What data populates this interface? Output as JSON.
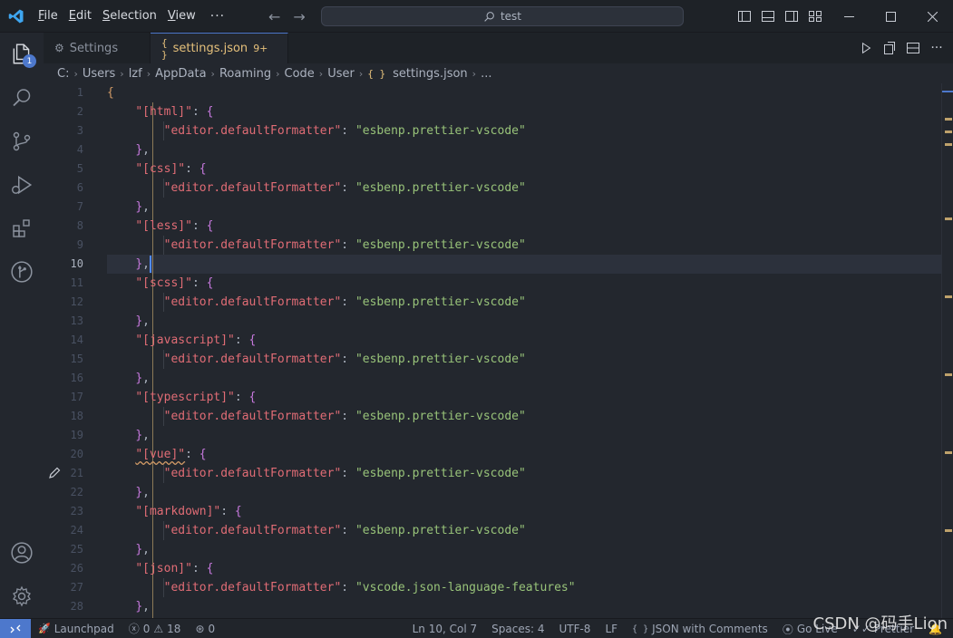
{
  "titlebar": {
    "menu": [
      {
        "label": "File",
        "mnemonic": "F",
        "rest": "ile"
      },
      {
        "label": "Edit",
        "mnemonic": "E",
        "rest": "dit"
      },
      {
        "label": "Selection",
        "mnemonic": "S",
        "rest": "election"
      },
      {
        "label": "View",
        "mnemonic": "V",
        "rest": "iew"
      }
    ],
    "more": "···",
    "search_text": "test"
  },
  "activity": {
    "explorer_badge": "1"
  },
  "tabs": [
    {
      "label": "Settings",
      "icon": "gear-icon"
    },
    {
      "label": "settings.json",
      "icon": "json-braces-icon",
      "problems": "9+"
    }
  ],
  "breadcrumb": [
    "C:",
    "Users",
    "lzf",
    "AppData",
    "Roaming",
    "Code",
    "User",
    "settings.json",
    "..."
  ],
  "breadcrumb_json_icon": "{ }",
  "editor": {
    "current_line": 10,
    "line_numbers": [
      "1",
      "2",
      "3",
      "4",
      "5",
      "6",
      "7",
      "8",
      "9",
      "10",
      "11",
      "12",
      "13",
      "14",
      "15",
      "16",
      "17",
      "18",
      "19",
      "20",
      "21",
      "22",
      "23",
      "24",
      "25",
      "26",
      "27",
      "28"
    ],
    "lines": [
      {
        "indent": 0,
        "parts": [
          {
            "t": "{",
            "c": "brace1"
          }
        ]
      },
      {
        "indent": 1,
        "parts": [
          {
            "t": "\"[html]\"",
            "c": "k"
          },
          {
            "t": ": ",
            "c": "p"
          },
          {
            "t": "{",
            "c": "brace2"
          }
        ]
      },
      {
        "indent": 2,
        "parts": [
          {
            "t": "\"editor.defaultFormatter\"",
            "c": "k"
          },
          {
            "t": ": ",
            "c": "p"
          },
          {
            "t": "\"esbenp.prettier-vscode\"",
            "c": "s"
          }
        ]
      },
      {
        "indent": 1,
        "parts": [
          {
            "t": "}",
            "c": "brace2"
          },
          {
            "t": ",",
            "c": "p"
          }
        ]
      },
      {
        "indent": 1,
        "parts": [
          {
            "t": "\"[css]\"",
            "c": "k"
          },
          {
            "t": ": ",
            "c": "p"
          },
          {
            "t": "{",
            "c": "brace2"
          }
        ]
      },
      {
        "indent": 2,
        "parts": [
          {
            "t": "\"editor.defaultFormatter\"",
            "c": "k"
          },
          {
            "t": ": ",
            "c": "p"
          },
          {
            "t": "\"esbenp.prettier-vscode\"",
            "c": "s"
          }
        ]
      },
      {
        "indent": 1,
        "parts": [
          {
            "t": "}",
            "c": "brace2"
          },
          {
            "t": ",",
            "c": "p"
          }
        ]
      },
      {
        "indent": 1,
        "parts": [
          {
            "t": "\"[less]\"",
            "c": "k"
          },
          {
            "t": ": ",
            "c": "p"
          },
          {
            "t": "{",
            "c": "brace2"
          }
        ]
      },
      {
        "indent": 2,
        "parts": [
          {
            "t": "\"editor.defaultFormatter\"",
            "c": "k"
          },
          {
            "t": ": ",
            "c": "p"
          },
          {
            "t": "\"esbenp.prettier-vscode\"",
            "c": "s"
          }
        ]
      },
      {
        "indent": 1,
        "parts": [
          {
            "t": "}",
            "c": "brace2"
          },
          {
            "t": ",",
            "c": "p"
          }
        ]
      },
      {
        "indent": 1,
        "parts": [
          {
            "t": "\"[scss]\"",
            "c": "k"
          },
          {
            "t": ": ",
            "c": "p"
          },
          {
            "t": "{",
            "c": "brace2"
          }
        ]
      },
      {
        "indent": 2,
        "parts": [
          {
            "t": "\"editor.defaultFormatter\"",
            "c": "k"
          },
          {
            "t": ": ",
            "c": "p"
          },
          {
            "t": "\"esbenp.prettier-vscode\"",
            "c": "s"
          }
        ]
      },
      {
        "indent": 1,
        "parts": [
          {
            "t": "}",
            "c": "brace2"
          },
          {
            "t": ",",
            "c": "p"
          }
        ]
      },
      {
        "indent": 1,
        "parts": [
          {
            "t": "\"[javascript]\"",
            "c": "k"
          },
          {
            "t": ": ",
            "c": "p"
          },
          {
            "t": "{",
            "c": "brace2"
          }
        ]
      },
      {
        "indent": 2,
        "parts": [
          {
            "t": "\"editor.defaultFormatter\"",
            "c": "k"
          },
          {
            "t": ": ",
            "c": "p"
          },
          {
            "t": "\"esbenp.prettier-vscode\"",
            "c": "s"
          }
        ]
      },
      {
        "indent": 1,
        "parts": [
          {
            "t": "}",
            "c": "brace2"
          },
          {
            "t": ",",
            "c": "p"
          }
        ]
      },
      {
        "indent": 1,
        "parts": [
          {
            "t": "\"[typescript]\"",
            "c": "k"
          },
          {
            "t": ": ",
            "c": "p"
          },
          {
            "t": "{",
            "c": "brace2"
          }
        ]
      },
      {
        "indent": 2,
        "parts": [
          {
            "t": "\"editor.defaultFormatter\"",
            "c": "k"
          },
          {
            "t": ": ",
            "c": "p"
          },
          {
            "t": "\"esbenp.prettier-vscode\"",
            "c": "s"
          }
        ]
      },
      {
        "indent": 1,
        "parts": [
          {
            "t": "}",
            "c": "brace2"
          },
          {
            "t": ",",
            "c": "p"
          }
        ]
      },
      {
        "indent": 1,
        "parts": [
          {
            "t": "\"[vue]\"",
            "c": "k",
            "squiggle": true
          },
          {
            "t": ": ",
            "c": "p"
          },
          {
            "t": "{",
            "c": "brace2"
          }
        ]
      },
      {
        "indent": 2,
        "parts": [
          {
            "t": "\"editor.defaultFormatter\"",
            "c": "k"
          },
          {
            "t": ": ",
            "c": "p"
          },
          {
            "t": "\"esbenp.prettier-vscode\"",
            "c": "s"
          }
        ]
      },
      {
        "indent": 1,
        "parts": [
          {
            "t": "}",
            "c": "brace2"
          },
          {
            "t": ",",
            "c": "p"
          }
        ]
      },
      {
        "indent": 1,
        "parts": [
          {
            "t": "\"[markdown]\"",
            "c": "k"
          },
          {
            "t": ": ",
            "c": "p"
          },
          {
            "t": "{",
            "c": "brace2"
          }
        ]
      },
      {
        "indent": 2,
        "parts": [
          {
            "t": "\"editor.defaultFormatter\"",
            "c": "k"
          },
          {
            "t": ": ",
            "c": "p"
          },
          {
            "t": "\"esbenp.prettier-vscode\"",
            "c": "s"
          }
        ]
      },
      {
        "indent": 1,
        "parts": [
          {
            "t": "}",
            "c": "brace2"
          },
          {
            "t": ",",
            "c": "p"
          }
        ]
      },
      {
        "indent": 1,
        "parts": [
          {
            "t": "\"[json]\"",
            "c": "k"
          },
          {
            "t": ": ",
            "c": "p"
          },
          {
            "t": "{",
            "c": "brace2"
          }
        ]
      },
      {
        "indent": 2,
        "parts": [
          {
            "t": "\"editor.defaultFormatter\"",
            "c": "k"
          },
          {
            "t": ": ",
            "c": "p"
          },
          {
            "t": "\"vscode.json-language-features\"",
            "c": "s"
          }
        ]
      },
      {
        "indent": 1,
        "parts": [
          {
            "t": "}",
            "c": "brace2"
          },
          {
            "t": ",",
            "c": "p"
          }
        ]
      }
    ]
  },
  "statusbar": {
    "launchpad": "Launchpad",
    "errors": "0",
    "warnings": "18",
    "ports": "0",
    "position": "Ln 10, Col 7",
    "spaces": "Spaces: 4",
    "encoding": "UTF-8",
    "eol": "LF",
    "language_icon": "{ }",
    "language": "JSON with Comments",
    "golive": "Go Live",
    "prettier": "Prettier"
  },
  "watermark": "CSDN @码手Lion",
  "colors": {
    "accent": "#4d78cc",
    "key": "#e06c75",
    "string": "#98c379",
    "brace_outer": "#d19a66",
    "brace_inner": "#c678dd",
    "tab_active_text": "#e5c07b"
  }
}
